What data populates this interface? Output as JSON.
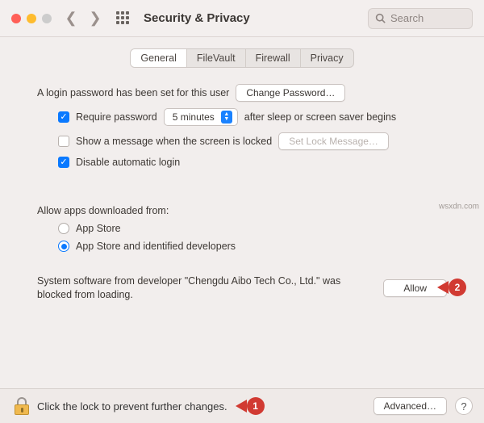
{
  "header": {
    "title": "Security & Privacy",
    "search_placeholder": "Search"
  },
  "tabs": [
    "General",
    "FileVault",
    "Firewall",
    "Privacy"
  ],
  "activeTab": 0,
  "loginPassword": {
    "intro": "A login password has been set for this user",
    "change_btn": "Change Password…",
    "require_label": "Require password",
    "delay_value": "5 minutes",
    "after_text": "after sleep or screen saver begins",
    "show_message_label": "Show a message when the screen is locked",
    "set_lock_btn": "Set Lock Message…",
    "disable_auto_label": "Disable automatic login"
  },
  "allowApps": {
    "heading": "Allow apps downloaded from:",
    "opt1": "App Store",
    "opt2": "App Store and identified developers"
  },
  "blocked": {
    "text": "System software from developer \"Chengdu Aibo Tech Co., Ltd.\" was blocked from loading.",
    "allow_btn": "Allow"
  },
  "footer": {
    "lock_text": "Click the lock to prevent further changes.",
    "advanced_btn": "Advanced…",
    "help": "?"
  },
  "markers": {
    "m1": "1",
    "m2": "2"
  },
  "watermark": "wsxdn.com"
}
